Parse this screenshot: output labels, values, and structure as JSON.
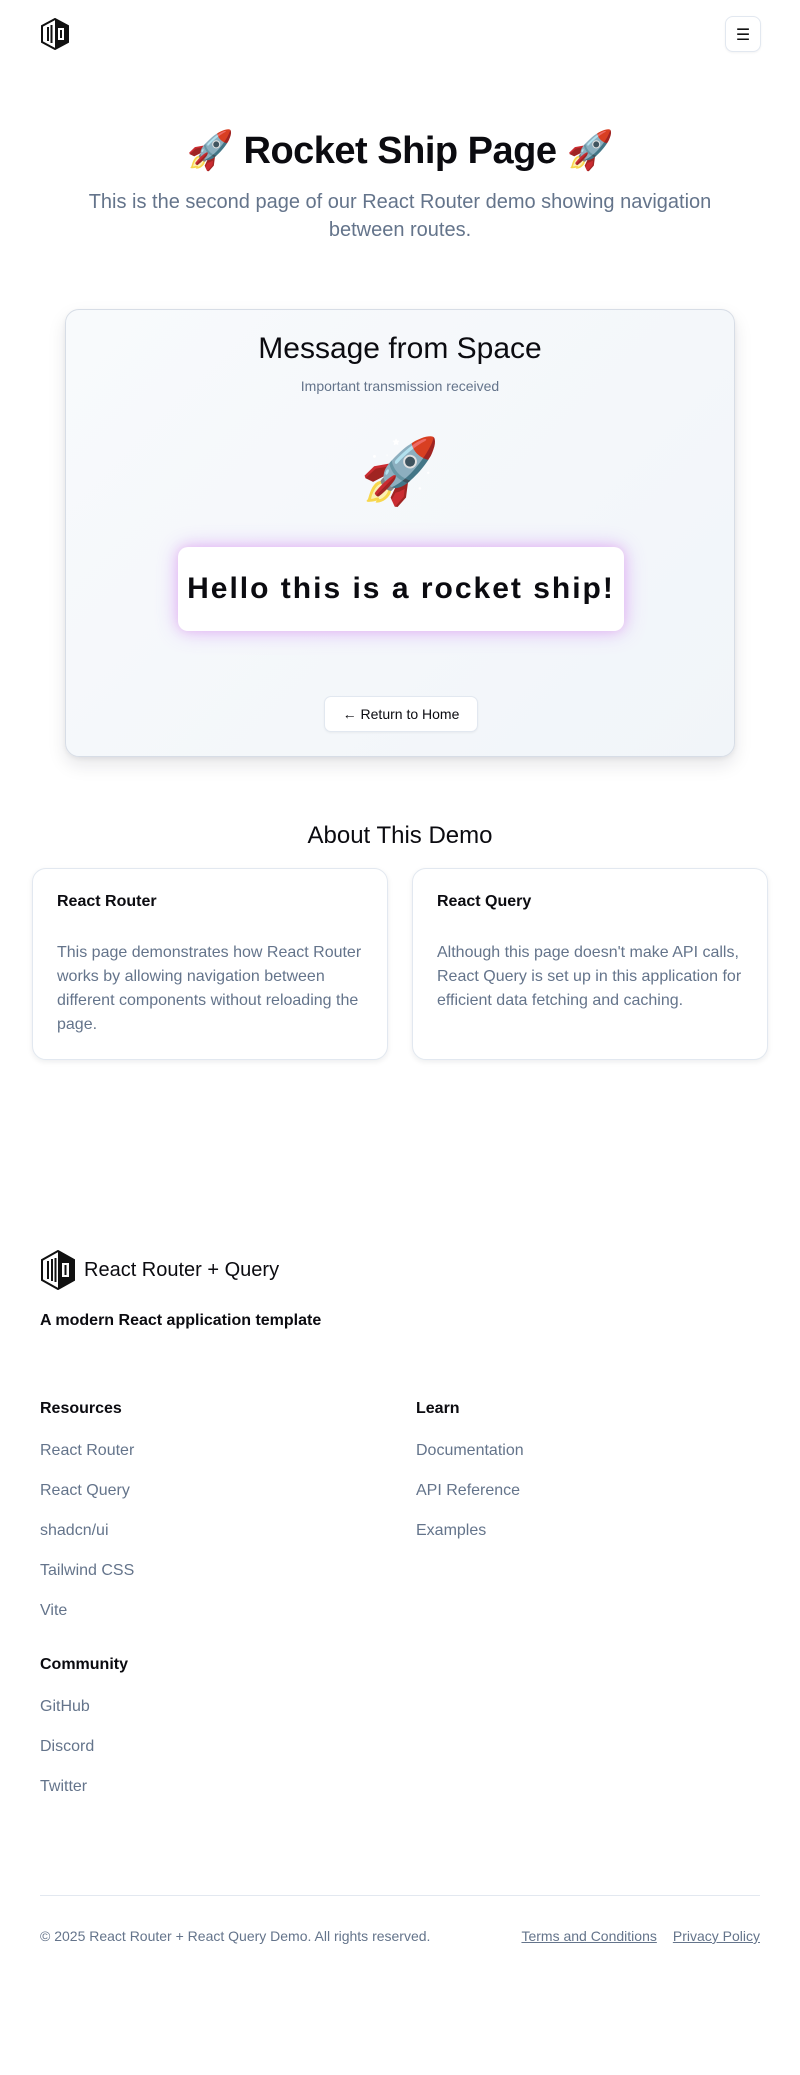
{
  "header": {
    "logo_icon": "hexagon-logo-icon",
    "menu_icon": "hamburger-menu-icon",
    "menu_glyph": "☰"
  },
  "hero": {
    "rocket_emoji": "🚀",
    "title": "Rocket Ship Page",
    "subtitle": "This is the second page of our React Router demo showing navigation between routes."
  },
  "message_card": {
    "title": "Message from Space",
    "subtitle": "Important transmission received",
    "rocket_emoji": "🚀",
    "message": "Hello this is a rocket ship!",
    "return_button": "← Return to Home",
    "glow_color": "#c06eff"
  },
  "about": {
    "title": "About This Demo",
    "cards": [
      {
        "title": "React Router",
        "body": "This page demonstrates how React Router works by allowing navigation between different components without reloading the page."
      },
      {
        "title": "React Query",
        "body": "Although this page doesn't make API calls, React Query is set up in this application for efficient data fetching and caching."
      }
    ]
  },
  "footer": {
    "brand": "React Router + Query",
    "tagline": "A modern React application template",
    "columns": [
      {
        "heading": "Resources",
        "links": [
          "React Router",
          "React Query",
          "shadcn/ui",
          "Tailwind CSS",
          "Vite"
        ]
      },
      {
        "heading": "Learn",
        "links": [
          "Documentation",
          "API Reference",
          "Examples"
        ]
      },
      {
        "heading": "Community",
        "links": [
          "GitHub",
          "Discord",
          "Twitter"
        ]
      }
    ],
    "copyright": "© 2025 React Router + React Query Demo. All rights reserved.",
    "legal": [
      "Terms and Conditions",
      "Privacy Policy"
    ]
  },
  "colors": {
    "text": "#0b0b10",
    "muted": "#64748b",
    "border": "#e2e8f0"
  }
}
